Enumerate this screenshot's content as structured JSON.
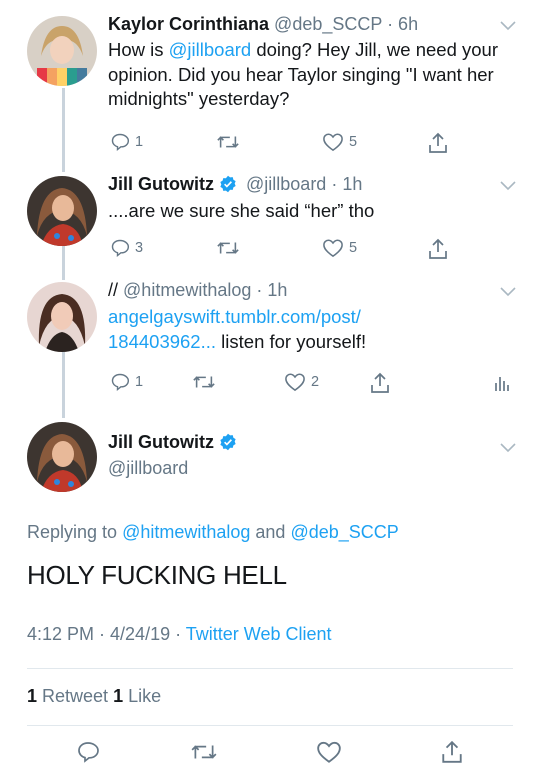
{
  "tweets": [
    {
      "name": "Kaylor Corinthiana",
      "handle": "@deb_SCCP",
      "time": "· 6h",
      "text_pre": "How is ",
      "mention": "@jillboard",
      "text_post": " doing? Hey Jill, we need your opinion. Did you hear Taylor singing \"I want her midnights\" yesterday?",
      "replies": "1",
      "retweets": "",
      "likes": "5"
    },
    {
      "name": "Jill Gutowitz",
      "handle": "@jillboard",
      "time": "· 1h",
      "text": "....are we sure she said “her” tho",
      "replies": "3",
      "retweets": "",
      "likes": "5"
    },
    {
      "name": "//",
      "handle": "@hitmewithalog",
      "time": "· 1h",
      "link_text": "angelgayswift.tumblr.com/post/184403962...",
      "link_line1": "angelgayswift.tumblr.com/post/",
      "link_line2": "184403962...",
      "text_post": " listen for yourself!",
      "replies": "1",
      "retweets": "",
      "likes": "2"
    }
  ],
  "main_tweet": {
    "name": "Jill Gutowitz",
    "handle": "@jillboard",
    "replying_prefix": "Replying to ",
    "replying_user1": "@hitmewithalog",
    "replying_and": " and ",
    "replying_user2": "@deb_SCCP",
    "text": "HOLY FUCKING HELL",
    "time": "4:12 PM · 4/24/19 · ",
    "client": "Twitter Web Client",
    "retweet_count": "1",
    "retweet_label": " Retweet ",
    "like_count": "1",
    "like_label": " Like"
  },
  "colors": {
    "link": "#1da1f2",
    "secondary_text": "#657786",
    "verified": "#1da1f2",
    "thread_line": "#c9d3dc"
  },
  "icons": [
    "reply-icon",
    "retweet-icon",
    "like-icon",
    "share-icon",
    "analytics-icon",
    "verified-badge-icon",
    "chevron-down-icon"
  ]
}
